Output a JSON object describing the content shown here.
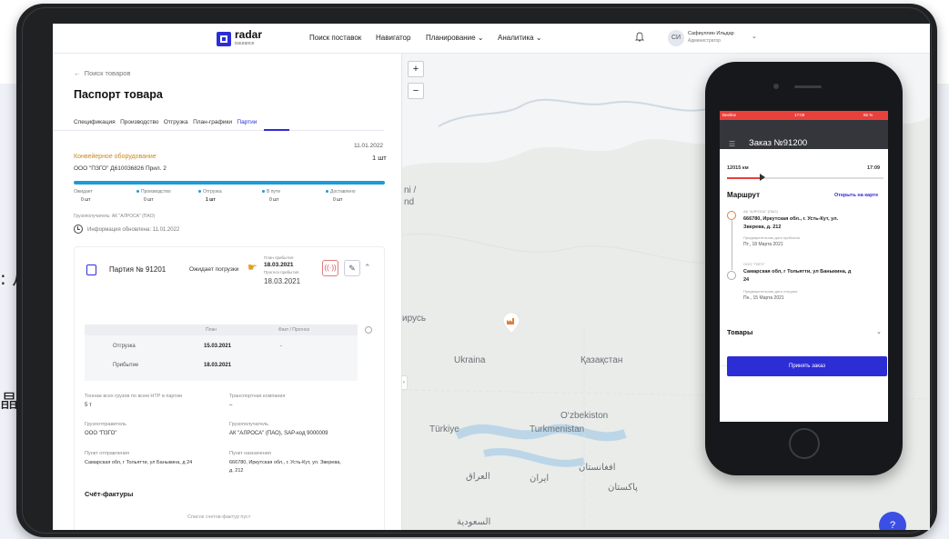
{
  "background": {
    "cn_text_1": ": 从提",
    "cn_text_2": "晶"
  },
  "topbar": {
    "logo": "radar",
    "logo_sub": "issurance",
    "nav": [
      "Поиск поставок",
      "Навигатор",
      "Планирование",
      "Аналитика"
    ],
    "avatar_initials": "СИ",
    "user_name": "Сафиуллин Ильдар",
    "user_role": "Администратор"
  },
  "panel": {
    "back": "Поиск товаров",
    "title": "Паспорт товара",
    "tabs": [
      "Спецификация",
      "Производство",
      "Отгрузка",
      "План-графики",
      "Партии"
    ],
    "active_tab": "Партии",
    "product": {
      "date": "11.01.2022",
      "name": "Конвейерное оборудование",
      "qty": "1 шт",
      "org": "ООО \"ПЗГО\"  Д610036826  Прил. 2"
    },
    "stages": [
      {
        "label": "Ожидает",
        "value": "0 шт"
      },
      {
        "label": "Производство",
        "value": "0 шт"
      },
      {
        "label": "Отгрузка",
        "value": "1 шт"
      },
      {
        "label": "В пути",
        "value": "0 шт"
      },
      {
        "label": "Доставлено",
        "value": "0 шт"
      }
    ],
    "progress_fraction": 1.0,
    "consignee": "Грузополучатель: АК \"АЛРОСА\" (ПАО)",
    "updated": "Информация обновлена: 11.01.2022",
    "party": {
      "name": "Партия № 91201",
      "status": "Ожидает погрузки",
      "plan_label": "План прибытия",
      "plan_date": "18.03.2021",
      "forecast_label": "Прогноз прибытия",
      "forecast_date": "18.03.2021",
      "table_headers": [
        "План",
        "Факт / Прогноз"
      ],
      "rows": [
        {
          "label": "Отгрузка",
          "plan": "15.03.2021",
          "fact": "-"
        },
        {
          "label": "Прибытие",
          "plan": "18.03.2021",
          "fact": ""
        }
      ],
      "tonnage_label": "Тоннаж всех грузов по всем НТР в партии",
      "tonnage": "5 т",
      "transport_label": "Транспортная компания",
      "transport": "–",
      "sender_label": "Грузоотправитель",
      "sender": "ООО \"ПЗГО\"",
      "receiver_label": "Грузополучатель",
      "receiver": "АК \"АЛРОСА\" (ПАО), SAP-код 9000009",
      "from_label": "Пункт отправления",
      "from": "Самарская обл, г Тольятти, ул Баныкина, д 24",
      "to_label": "Пункт назначения",
      "to_line1": "666780, Иркутская обл., г. Усть-Кут, ул. Зверева,",
      "to_line2": "д. 212",
      "invoices_title": "Счёт-фактуры",
      "invoices_empty": "Список счетов-фактур пуст"
    }
  },
  "map": {
    "labels": [
      "Ukraina",
      "Қазақстан",
      "O‘zbekiston",
      "Türkiye",
      "Turkmenistan",
      "العراق",
      "ایران",
      "افغانستان",
      "پاکستان",
      "ирусь",
      "nd",
      "ni /",
      "السعودية"
    ],
    "zoom_in": "+",
    "zoom_out": "−",
    "collapse": "‹ ›",
    "help": "?"
  },
  "phone": {
    "status": "Beeline",
    "time": "17:09",
    "battery": "65 %",
    "order_title": "Заказ №91200",
    "distance": "12015 км",
    "eta": "17:09",
    "route_title": "Маршрут",
    "open_map": "Открыть на карте",
    "stop1": {
      "org": "АК \"АЛРОСА\" (ПАО)",
      "line1": "666780, Иркутская обл., г. Усть-Кут, ул.",
      "line2": "Зверева, д. 212",
      "date_label": "Предварительная дата прибытия",
      "date": "Пт., 18 Марта 2021"
    },
    "stop2": {
      "org": "ООО \"ПЗГО\"",
      "line1": "Самарская обл, г Тольятти, ул Баныкина, д",
      "line2": "24",
      "date_label": "Предварительная дата отгрузки",
      "date": "Пн., 15 Марта 2021"
    },
    "goods": "Товары",
    "accept": "Принять заказ"
  }
}
